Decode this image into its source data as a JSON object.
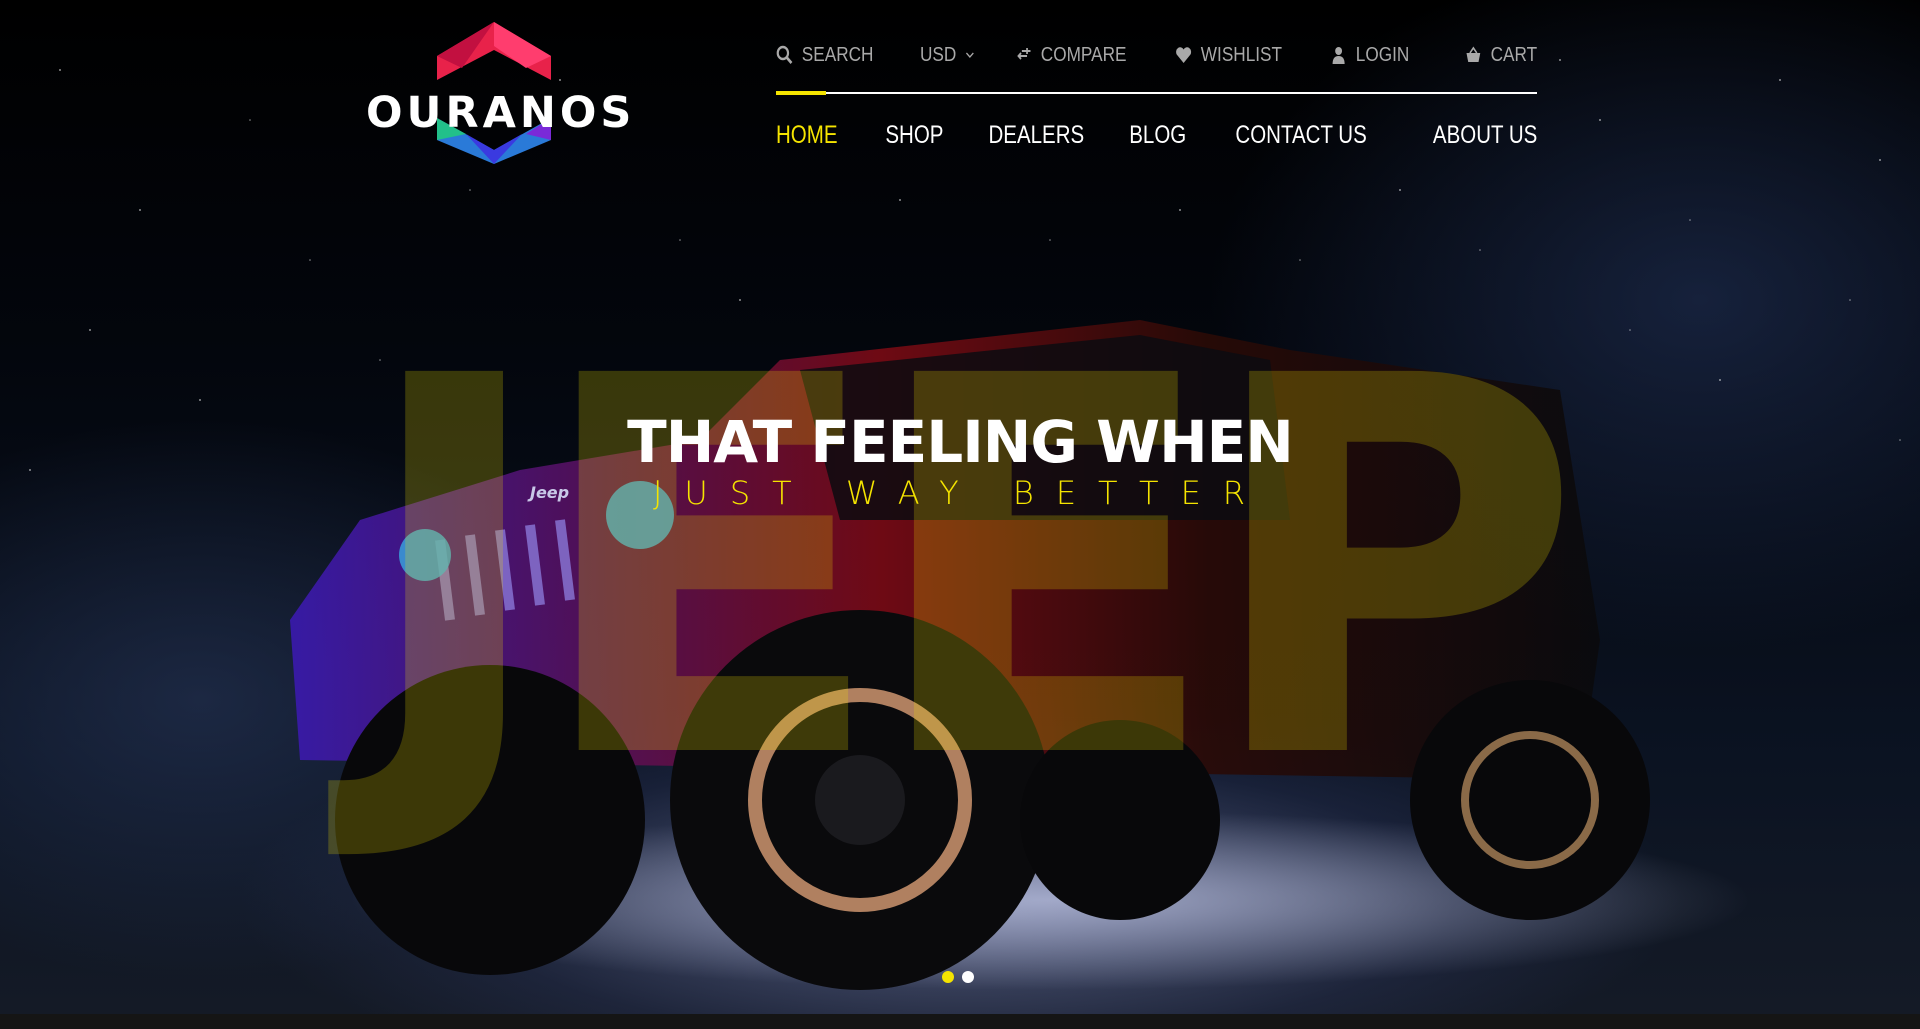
{
  "brand": {
    "name": "OURANOS"
  },
  "utility_bar": {
    "search_label": "SEARCH",
    "currency_label": "USD",
    "compare_label": "COMPARE",
    "wishlist_label": "WISHLIST",
    "login_label": "LOGIN",
    "cart_label": "CART"
  },
  "main_nav": {
    "items": [
      {
        "label": "HOME",
        "active": true
      },
      {
        "label": "SHOP"
      },
      {
        "label": "DEALERS"
      },
      {
        "label": "BLOG"
      },
      {
        "label": "CONTACT US"
      },
      {
        "label": "ABOUT US"
      }
    ]
  },
  "hero": {
    "headline": "THAT FEELING WHEN",
    "subline": "JUST WAY BETTER",
    "background_word": "JEEP",
    "badge_text": "Jeep",
    "slide_count": 2,
    "active_slide": 1
  },
  "colors": {
    "accent": "#f5e400",
    "background": "#000000",
    "text": "#ffffff",
    "muted_text": "#a9a9a9"
  },
  "icons": {
    "search": "search-icon",
    "currency": "chevron-down-icon",
    "compare": "compare-arrows-icon",
    "wishlist": "heart-icon",
    "login": "user-icon",
    "cart": "basket-icon"
  }
}
